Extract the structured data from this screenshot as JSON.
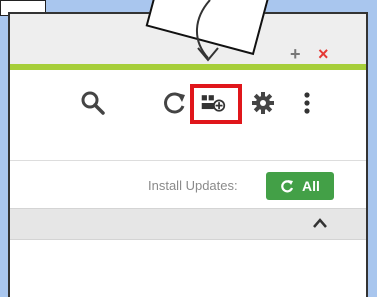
{
  "window": {
    "new_tab_symbol": "+",
    "close_symbol": "×"
  },
  "toolbar": {
    "icons": [
      "search-icon",
      "refresh-icon",
      "add-ons-icon",
      "gear-icon",
      "more-vert-icon"
    ]
  },
  "updates": {
    "install_label": "Install Updates:",
    "all_button_label": "All"
  },
  "colors": {
    "accent_green": "#a6ce39",
    "button_green": "#43a047",
    "highlight_red": "#e0161b",
    "close_red": "#e53935"
  }
}
